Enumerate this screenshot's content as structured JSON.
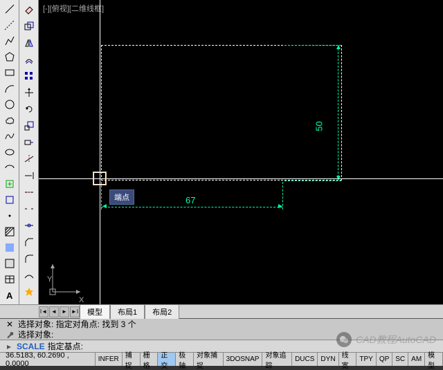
{
  "view_label": "[-][俯视][二维线框]",
  "tooltip_text": "端点",
  "dimensions": {
    "width": "67",
    "height": "50"
  },
  "ucs": {
    "x": "X",
    "y": "Y"
  },
  "tabs": {
    "model": "模型",
    "layout1": "布局1",
    "layout2": "布局2"
  },
  "command": {
    "line1": "选择对象: 指定对角点: 找到 3 个",
    "line2": "选择对象:",
    "prompt_cmd": "SCALE",
    "prompt_text": "指定基点:"
  },
  "status": {
    "coords": "36.5183, 60.2690 , 0.0000",
    "buttons": [
      "INFER",
      "捕捉",
      "栅格",
      "正交",
      "极轴",
      "对象捕捉",
      "3DOSNAP",
      "对象追踪",
      "DUCS",
      "DYN",
      "线宽",
      "TPY",
      "QP",
      "SC",
      "AM",
      "模型"
    ],
    "active_idx": 3
  },
  "watermark": "CAD教程AutoCAD"
}
